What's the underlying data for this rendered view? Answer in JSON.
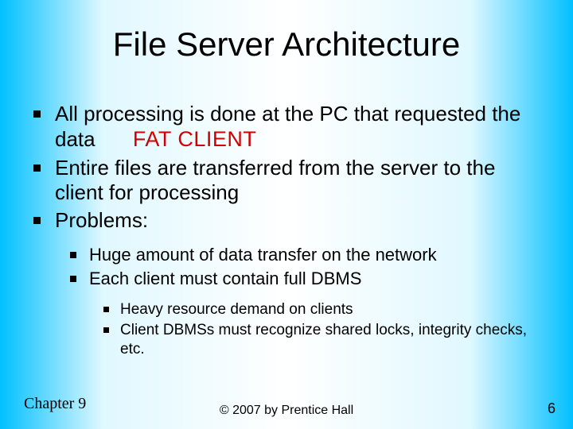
{
  "title": "File Server Architecture",
  "bullets_l1": [
    {
      "text_a": "All processing is done at the PC that requested the data",
      "callout": "FAT CLIENT"
    },
    {
      "text_a": "Entire files are transferred from the server to the client for processing"
    },
    {
      "text_a": "Problems:"
    }
  ],
  "bullets_l2": [
    "Huge amount of data transfer on the network",
    "Each client must contain full DBMS"
  ],
  "bullets_l3": [
    "Heavy resource demand on clients",
    "Client DBMSs must recognize shared locks, integrity checks, etc."
  ],
  "footer": {
    "left": "Chapter 9",
    "center": "© 2007 by Prentice Hall",
    "right": "6"
  }
}
